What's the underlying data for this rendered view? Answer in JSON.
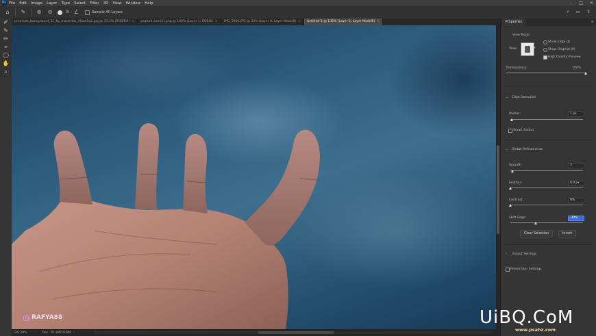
{
  "menu": {
    "items": [
      "File",
      "Edit",
      "Image",
      "Layer",
      "Type",
      "Select",
      "Filter",
      "3D",
      "View",
      "Window",
      "Help"
    ]
  },
  "window_controls": [
    "–",
    "□",
    "✕"
  ],
  "options_bar": {
    "brush_size": "8",
    "sample_all_layers": "Sample All Layers"
  },
  "tabs": [
    {
      "label": "premade_background_31_by_maiarcita_d6ww5q2.jpg @ 33.3% (RGB/8#)",
      "active": false
    },
    {
      "label": "psqfunt.com(1).png @ 100% (Layer 1, RGB/8)",
      "active": false
    },
    {
      "label": "IMG_5902.JPG @ 33% (Layer 0, Layer Mask/8)",
      "active": false
    },
    {
      "label": "Untitled-1 @ 135% (Layer 2, Layer Mask/8)",
      "active": true
    }
  ],
  "status": {
    "zoom": "135.29%",
    "doc": "Doc: 10.3M/10.6M"
  },
  "watermark": {
    "handle": "RAFYA88"
  },
  "site_watermark": {
    "main": "UiBQ.CoM",
    "sub": "www.psahz.com"
  },
  "properties": {
    "tab": "Properties",
    "view_mode": {
      "title": "View Mode",
      "view_label": "View:",
      "show_edge": "Show Edge (J)",
      "show_original": "Show Original (P)",
      "high_quality": "High Quality Preview"
    },
    "transparency": {
      "label": "Transparency",
      "value": "100%",
      "fraction": 1.0
    },
    "edge_detection": {
      "title": "Edge Detection",
      "radius_label": "Radius:",
      "radius_value": "1 px",
      "radius_fraction": 0.02,
      "smart_radius": "Smart Radius"
    },
    "global_refinements": {
      "title": "Global Refinements",
      "smooth_label": "Smooth:",
      "smooth_value": "3",
      "smooth_fraction": 0.03,
      "feather_label": "Feather:",
      "feather_value": "0.0 px",
      "feather_fraction": 0.0,
      "contrast_label": "Contrast:",
      "contrast_value": "0%",
      "contrast_fraction": 0.0,
      "shift_label": "Shift Edge:",
      "shift_value": "-30%",
      "shift_fraction": 0.35
    },
    "buttons": {
      "clear": "Clear Selection",
      "invert": "Invert"
    },
    "output_settings": "Output Settings",
    "remember_settings": "Remember Settings"
  }
}
